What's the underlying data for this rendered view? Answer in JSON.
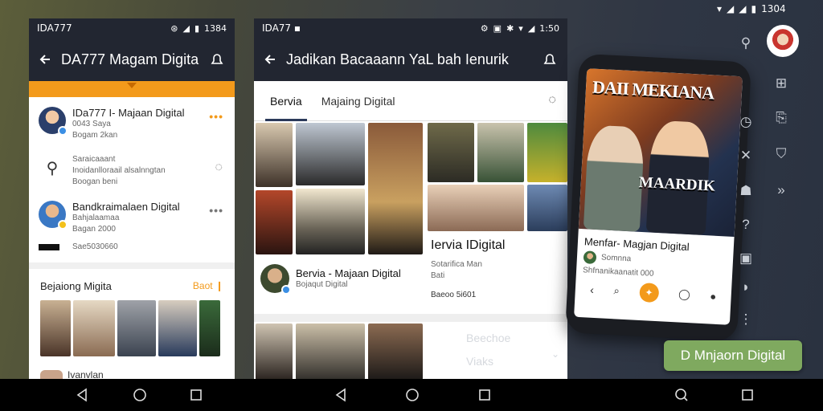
{
  "screen": {
    "status_right": "1304",
    "cta_label": "D Mnjaorn Digital"
  },
  "phone1": {
    "status_left": "IDA777",
    "status_time": "1384",
    "title": "DA777 Magam Digital",
    "feed": [
      {
        "title": "IDa777 I- Majaan Digital",
        "line1": "0043 Saya",
        "line2": "Bogam 2kan"
      },
      {
        "line1": "Saraicaaant",
        "line2": "Inoidanlloraail alsalnngtan",
        "line3": "Boogan beni"
      },
      {
        "title": "Bandkraimalaen Digital",
        "line1": "Bahjalaamaa",
        "line2": "Bagan 2000"
      },
      {
        "line1": "Sae5030660"
      }
    ],
    "section_title": "Bejaiong Migita",
    "section_more": "Baot"
  },
  "phone2": {
    "status_left": "IDA77",
    "status_time": "1:50",
    "title": "Jadikan Bacaaann YaL bah Ienurik",
    "tabs": [
      "Bervia",
      "Majaing Digital"
    ],
    "card_left": {
      "title": "Bervia - Majaan Digital",
      "sub": "Bojaqut Digital"
    },
    "card_right": {
      "title": "Iervia IDigital",
      "sub1": "Sotarifica Man",
      "sub2": "Bati",
      "foot": "Baeoo 5i601"
    },
    "below_labels": [
      "Beechoe",
      "Viaks"
    ]
  },
  "phone3": {
    "poster_title": "DAII MEKIANA",
    "poster_tag": "MAARDIK",
    "caption_title": "Menfar- Magjan Digital",
    "caption_user": "Somnna",
    "caption_meta": "Shfnanikaanatit 000"
  },
  "colors": {
    "accent_orange": "#f39a1b",
    "appbar_dark": "#222631",
    "cta_green": "#7fa95f"
  },
  "icons": [
    "back-arrow-icon",
    "bell-icon",
    "search-icon",
    "chat-icon",
    "home-icon",
    "recents-icon"
  ]
}
